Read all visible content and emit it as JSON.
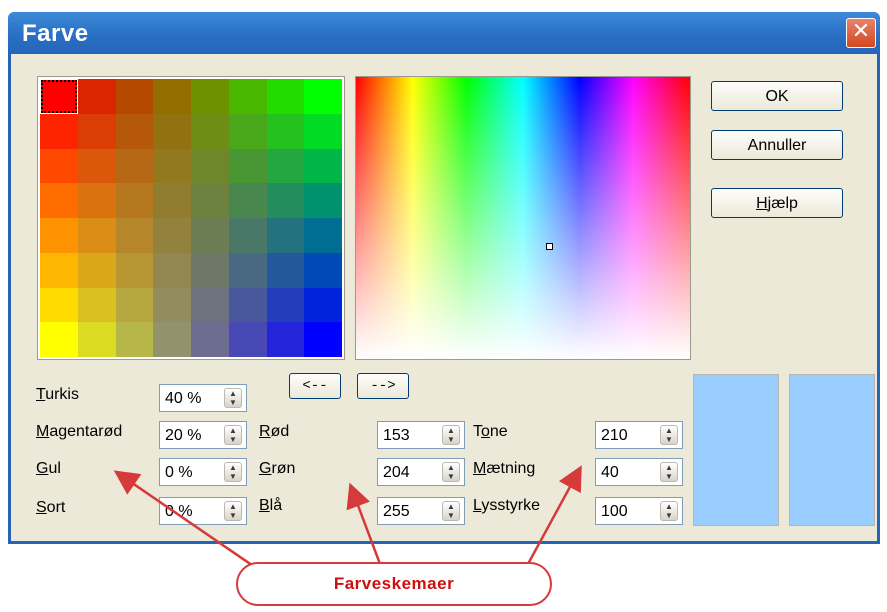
{
  "window": {
    "title": "Farve"
  },
  "buttons": {
    "ok": "OK",
    "cancel": "Annuller",
    "help": "Hjælp",
    "to_left": "<--",
    "to_right": "-->"
  },
  "cmyk": [
    {
      "label": "Turkis",
      "value": "40 %"
    },
    {
      "label": "Magentarød",
      "value": "20 %"
    },
    {
      "label": "Gul",
      "value": "0 %"
    },
    {
      "label": "Sort",
      "value": "0 %"
    }
  ],
  "rgb": [
    {
      "label": "Rød",
      "value": "153"
    },
    {
      "label": "Grøn",
      "value": "204"
    },
    {
      "label": "Blå",
      "value": "255"
    }
  ],
  "hsb": [
    {
      "label": "Tone",
      "value": "210"
    },
    {
      "label": "Mætning",
      "value": "40"
    },
    {
      "label": "Lysstyrke",
      "value": "100"
    }
  ],
  "preview_color": "#99ccff",
  "annotation": {
    "label": "Farveskemaer",
    "color": "#d63a3a"
  }
}
